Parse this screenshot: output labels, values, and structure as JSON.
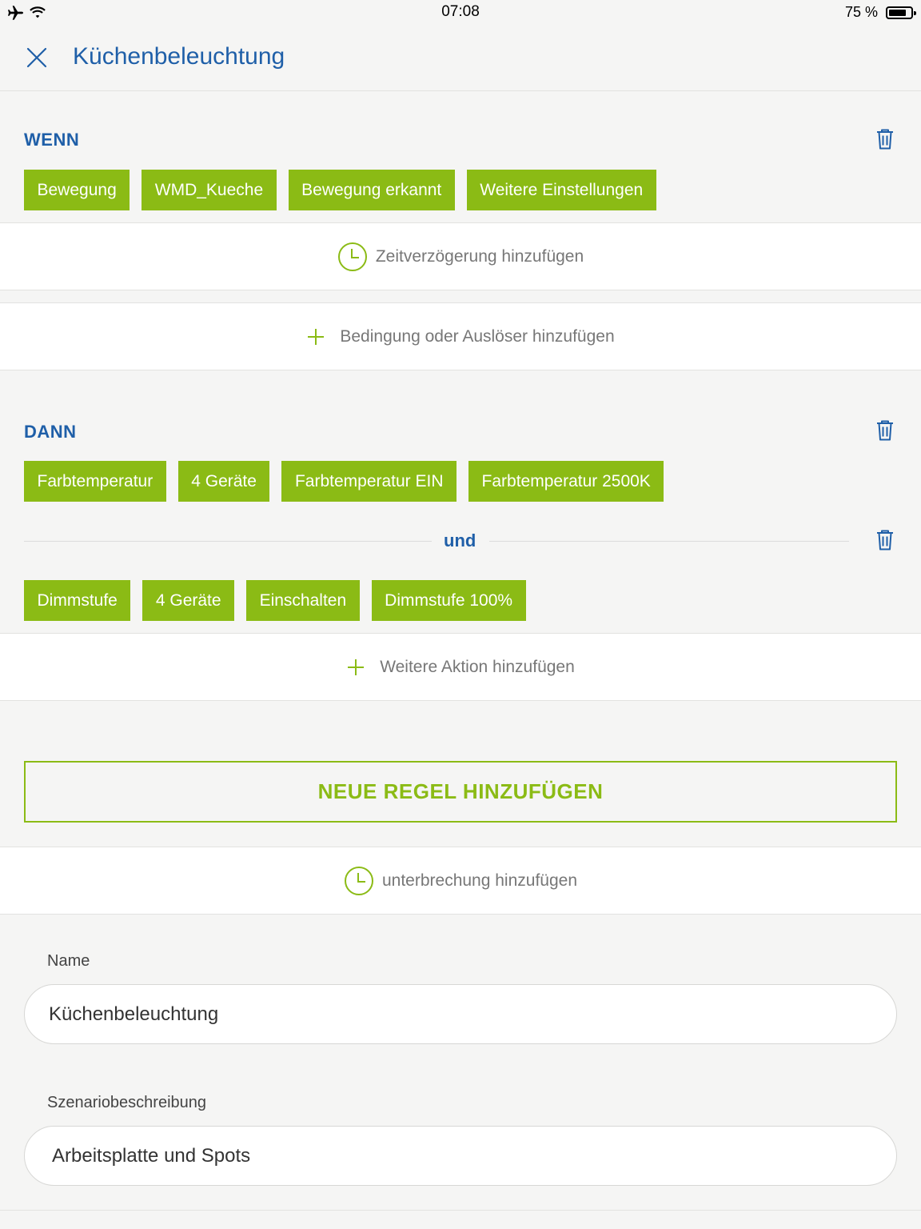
{
  "status_bar": {
    "time": "07:08",
    "battery_percent": "75 %",
    "icons": [
      "airplane-icon",
      "wifi-icon",
      "battery-icon"
    ]
  },
  "header": {
    "title": "Küchenbeleuchtung",
    "close_icon": "close-icon"
  },
  "wenn": {
    "title": "WENN",
    "chips": [
      "Bewegung",
      "WMD_Kueche",
      "Bewegung erkannt",
      "Weitere Einstellungen"
    ],
    "delay_label": "Zeitverzögerung hinzufügen",
    "add_condition_label": "Bedingung oder Auslöser hinzufügen"
  },
  "dann": {
    "title": "DANN",
    "action1_chips": [
      "Farbtemperatur",
      "4 Geräte",
      "Farbtemperatur EIN",
      "Farbtemperatur 2500K"
    ],
    "connector": "und",
    "action2_chips": [
      "Dimmstufe",
      "4 Geräte",
      "Einschalten",
      "Dimmstufe 100%"
    ],
    "add_action_label": "Weitere Aktion hinzufügen"
  },
  "new_rule_label": "NEUE REGEL HINZUFÜGEN",
  "interruption_label": "unterbrechung hinzufügen",
  "form": {
    "name_label": "Name",
    "name_value": "Küchenbeleuchtung",
    "description_label": "Szenariobeschreibung",
    "description_value": "Arbeitsplatte und Spots"
  },
  "colors": {
    "accent_green": "#8bbb15",
    "primary_blue": "#1f5fa8",
    "background": "#f5f5f4"
  }
}
